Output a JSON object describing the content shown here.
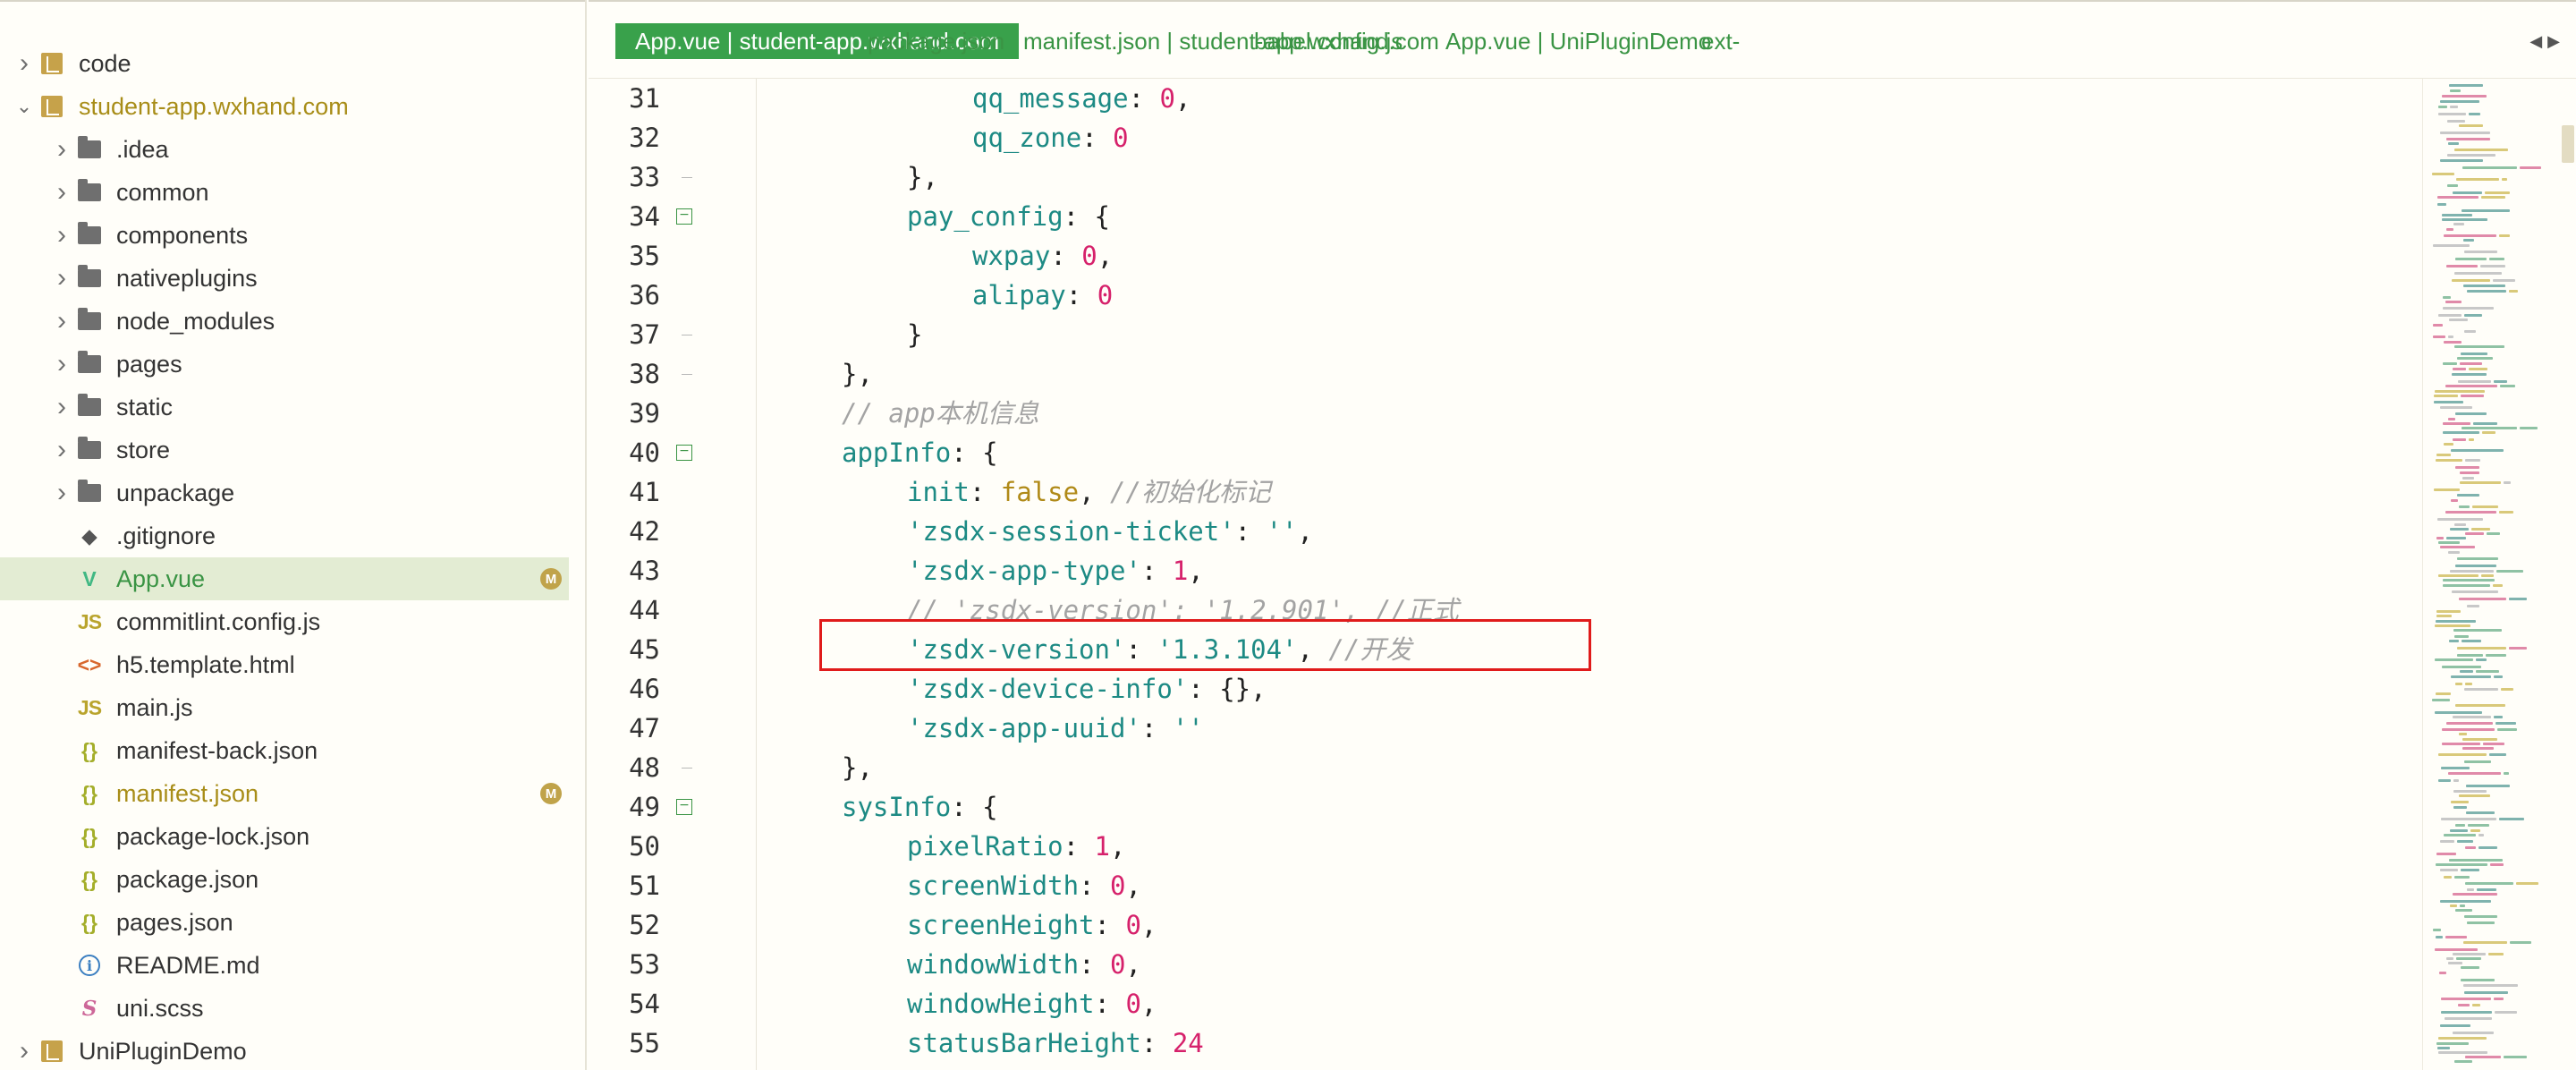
{
  "sidebar": {
    "items": [
      {
        "label": "code",
        "type": "project",
        "expanded": false,
        "level": 0
      },
      {
        "label": "student-app.wxhand.com",
        "type": "project",
        "expanded": true,
        "level": 0
      },
      {
        "label": ".idea",
        "type": "folder",
        "level": 1
      },
      {
        "label": "common",
        "type": "folder",
        "level": 1
      },
      {
        "label": "components",
        "type": "folder",
        "level": 1
      },
      {
        "label": "nativeplugins",
        "type": "folder",
        "level": 1
      },
      {
        "label": "node_modules",
        "type": "folder",
        "level": 1
      },
      {
        "label": "pages",
        "type": "folder",
        "level": 1
      },
      {
        "label": "static",
        "type": "folder",
        "level": 1
      },
      {
        "label": "store",
        "type": "folder",
        "level": 1
      },
      {
        "label": "unpackage",
        "type": "folder",
        "level": 1
      },
      {
        "label": ".gitignore",
        "type": "git",
        "level": 1
      },
      {
        "label": "App.vue",
        "type": "vue",
        "level": 1,
        "selected": true,
        "badge": "M"
      },
      {
        "label": "commitlint.config.js",
        "type": "js",
        "level": 1
      },
      {
        "label": "h5.template.html",
        "type": "html",
        "level": 1
      },
      {
        "label": "main.js",
        "type": "js",
        "level": 1
      },
      {
        "label": "manifest-back.json",
        "type": "json",
        "level": 1
      },
      {
        "label": "manifest.json",
        "type": "json",
        "level": 1,
        "modified": true,
        "badge": "M"
      },
      {
        "label": "package-lock.json",
        "type": "json",
        "level": 1
      },
      {
        "label": "package.json",
        "type": "json",
        "level": 1
      },
      {
        "label": "pages.json",
        "type": "json",
        "level": 1
      },
      {
        "label": "README.md",
        "type": "info",
        "level": 1
      },
      {
        "label": "uni.scss",
        "type": "scss",
        "level": 1
      },
      {
        "label": "UniPluginDemo",
        "type": "project",
        "expanded": false,
        "level": 0
      }
    ],
    "icon_glyphs": {
      "js": "JS",
      "json": "{}",
      "html": "<>",
      "vue": "V",
      "git": "◆",
      "info": "i",
      "scss": "S"
    }
  },
  "tabs": [
    {
      "label": "App.vue | student-app.wxhand.com",
      "active": true
    },
    {
      "label": "package.json"
    },
    {
      "label": "manifest.json | student-app.wxhand.com"
    },
    {
      "label": "babel.config.js"
    },
    {
      "label": "App.vue | UniPluginDemo"
    },
    {
      "label": "ext-"
    }
  ],
  "tab_nav": {
    "left": "◀",
    "right": "▶"
  },
  "editor": {
    "lines": [
      {
        "n": "31",
        "fold": "",
        "indent": 5,
        "tokens": [
          [
            "k",
            "qq_message"
          ],
          [
            "p",
            ": "
          ],
          [
            "n",
            "0"
          ],
          [
            "p",
            ","
          ]
        ]
      },
      {
        "n": "32",
        "fold": "",
        "indent": 5,
        "tokens": [
          [
            "k",
            "qq_zone"
          ],
          [
            "p",
            ": "
          ],
          [
            "n",
            "0"
          ]
        ]
      },
      {
        "n": "33",
        "fold": "end",
        "indent": 4,
        "tokens": [
          [
            "p",
            "},"
          ]
        ]
      },
      {
        "n": "34",
        "fold": "box",
        "indent": 4,
        "tokens": [
          [
            "k",
            "pay_config"
          ],
          [
            "p",
            ": {"
          ]
        ]
      },
      {
        "n": "35",
        "fold": "",
        "indent": 5,
        "tokens": [
          [
            "k",
            "wxpay"
          ],
          [
            "p",
            ": "
          ],
          [
            "n",
            "0"
          ],
          [
            "p",
            ","
          ]
        ]
      },
      {
        "n": "36",
        "fold": "",
        "indent": 5,
        "tokens": [
          [
            "k",
            "alipay"
          ],
          [
            "p",
            ": "
          ],
          [
            "n",
            "0"
          ]
        ]
      },
      {
        "n": "37",
        "fold": "end",
        "indent": 4,
        "tokens": [
          [
            "p",
            "}"
          ]
        ]
      },
      {
        "n": "38",
        "fold": "end",
        "indent": 3,
        "tokens": [
          [
            "p",
            "},"
          ]
        ]
      },
      {
        "n": "39",
        "fold": "",
        "indent": 3,
        "tokens": [
          [
            "c",
            "// app本机信息"
          ]
        ]
      },
      {
        "n": "40",
        "fold": "box",
        "indent": 3,
        "tokens": [
          [
            "k",
            "appInfo"
          ],
          [
            "p",
            ": {"
          ]
        ]
      },
      {
        "n": "41",
        "fold": "",
        "indent": 4,
        "tokens": [
          [
            "k",
            "init"
          ],
          [
            "p",
            ": "
          ],
          [
            "b",
            "false"
          ],
          [
            "p",
            ", "
          ],
          [
            "c",
            "//初始化标记"
          ]
        ]
      },
      {
        "n": "42",
        "fold": "",
        "indent": 4,
        "tokens": [
          [
            "s",
            "'zsdx-session-ticket'"
          ],
          [
            "p",
            ": "
          ],
          [
            "s",
            "''"
          ],
          [
            "p",
            ","
          ]
        ]
      },
      {
        "n": "43",
        "fold": "",
        "indent": 4,
        "tokens": [
          [
            "s",
            "'zsdx-app-type'"
          ],
          [
            "p",
            ": "
          ],
          [
            "n",
            "1"
          ],
          [
            "p",
            ","
          ]
        ]
      },
      {
        "n": "44",
        "fold": "",
        "indent": 4,
        "tokens": [
          [
            "c",
            "// 'zsdx-version': '1.2.901', //正式"
          ]
        ]
      },
      {
        "n": "45",
        "fold": "",
        "indent": 4,
        "tokens": [
          [
            "s",
            "'zsdx-version'"
          ],
          [
            "p",
            ": "
          ],
          [
            "s",
            "'1.3.104'"
          ],
          [
            "p",
            ", "
          ],
          [
            "c",
            "//开发"
          ]
        ]
      },
      {
        "n": "46",
        "fold": "",
        "indent": 4,
        "tokens": [
          [
            "s",
            "'zsdx-device-info'"
          ],
          [
            "p",
            ": {},"
          ]
        ]
      },
      {
        "n": "47",
        "fold": "",
        "indent": 4,
        "tokens": [
          [
            "s",
            "'zsdx-app-uuid'"
          ],
          [
            "p",
            ": "
          ],
          [
            "s",
            "''"
          ]
        ]
      },
      {
        "n": "48",
        "fold": "end",
        "indent": 3,
        "tokens": [
          [
            "p",
            "},"
          ]
        ]
      },
      {
        "n": "49",
        "fold": "box",
        "indent": 3,
        "tokens": [
          [
            "k",
            "sysInfo"
          ],
          [
            "p",
            ": {"
          ]
        ]
      },
      {
        "n": "50",
        "fold": "",
        "indent": 4,
        "tokens": [
          [
            "k",
            "pixelRatio"
          ],
          [
            "p",
            ": "
          ],
          [
            "n",
            "1"
          ],
          [
            "p",
            ","
          ]
        ]
      },
      {
        "n": "51",
        "fold": "",
        "indent": 4,
        "tokens": [
          [
            "k",
            "screenWidth"
          ],
          [
            "p",
            ": "
          ],
          [
            "n",
            "0"
          ],
          [
            "p",
            ","
          ]
        ]
      },
      {
        "n": "52",
        "fold": "",
        "indent": 4,
        "tokens": [
          [
            "k",
            "screenHeight"
          ],
          [
            "p",
            ": "
          ],
          [
            "n",
            "0"
          ],
          [
            "p",
            ","
          ]
        ]
      },
      {
        "n": "53",
        "fold": "",
        "indent": 4,
        "tokens": [
          [
            "k",
            "windowWidth"
          ],
          [
            "p",
            ": "
          ],
          [
            "n",
            "0"
          ],
          [
            "p",
            ","
          ]
        ]
      },
      {
        "n": "54",
        "fold": "",
        "indent": 4,
        "tokens": [
          [
            "k",
            "windowHeight"
          ],
          [
            "p",
            ": "
          ],
          [
            "n",
            "0"
          ],
          [
            "p",
            ","
          ]
        ]
      },
      {
        "n": "55",
        "fold": "",
        "indent": 4,
        "tokens": [
          [
            "k",
            "statusBarHeight"
          ],
          [
            "p",
            ": "
          ],
          [
            "n",
            "24"
          ]
        ]
      }
    ]
  },
  "colors": {
    "accent": "#39a14b",
    "highlight_border": "#e01b1b",
    "key": "#1d8a84",
    "number": "#d6216b",
    "comment": "#a3a3a3",
    "boolean": "#b08a18",
    "modified_badge": "#c0a34a"
  }
}
